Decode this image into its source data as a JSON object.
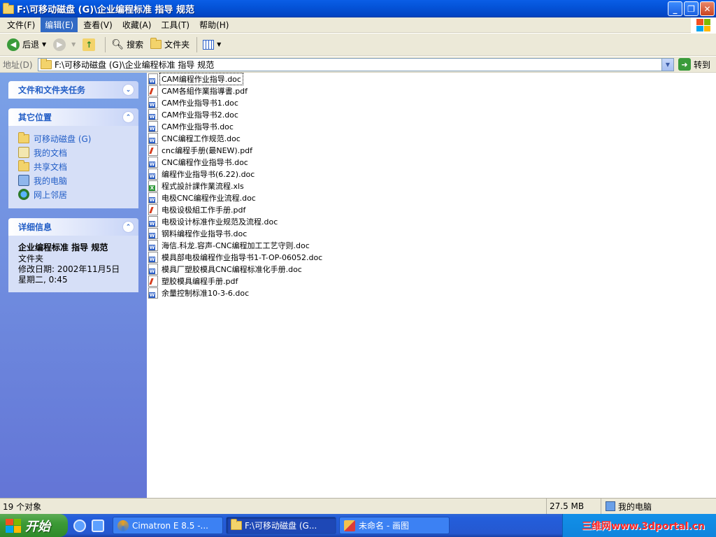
{
  "window": {
    "title": "F:\\可移动磁盘 (G)\\企业编程标准 指导 规范",
    "buttons": {
      "minimize": "_",
      "maximize": "❐",
      "close": "✕"
    }
  },
  "menu": [
    {
      "label": "文件(F)"
    },
    {
      "label": "编辑(E)"
    },
    {
      "label": "查看(V)"
    },
    {
      "label": "收藏(A)"
    },
    {
      "label": "工具(T)"
    },
    {
      "label": "帮助(H)"
    }
  ],
  "menu_active_index": 1,
  "toolbar": {
    "back": "后退",
    "search": "搜索",
    "folders": "文件夹"
  },
  "address": {
    "label": "地址(D)",
    "value": "F:\\可移动磁盘 (G)\\企业编程标准 指导 规范",
    "go": "转到"
  },
  "taskpane": {
    "tasks_title": "文件和文件夹任务",
    "other_title": "其它位置",
    "other_links": [
      {
        "label": "可移动磁盘 (G)",
        "icon": "folder-icon"
      },
      {
        "label": "我的文档",
        "icon": "documents-icon"
      },
      {
        "label": "共享文档",
        "icon": "folder-icon"
      },
      {
        "label": "我的电脑",
        "icon": "computer-icon"
      },
      {
        "label": "网上邻居",
        "icon": "network-icon"
      }
    ],
    "details_title": "详细信息",
    "details": {
      "name": "企业编程标准 指导 规范",
      "type": "文件夹",
      "modified_label": "修改日期: 2002年11月5日",
      "modified_time": "星期二, 0:45"
    }
  },
  "files": [
    {
      "name": "CAM编程作业指导.doc",
      "type": "doc"
    },
    {
      "name": "CAM各組作業指導書.pdf",
      "type": "pdf"
    },
    {
      "name": "CAM作业指导书1.doc",
      "type": "doc"
    },
    {
      "name": "CAM作业指导书2.doc",
      "type": "doc"
    },
    {
      "name": "CAM作业指导书.doc",
      "type": "doc"
    },
    {
      "name": "CNC编程工作规范.doc",
      "type": "doc"
    },
    {
      "name": "cnc编程手册(最NEW).pdf",
      "type": "pdf"
    },
    {
      "name": "CNC编程作业指导书.doc",
      "type": "doc"
    },
    {
      "name": "编程作业指导书(6.22).doc",
      "type": "doc"
    },
    {
      "name": "程式設計課作業流程.xls",
      "type": "xls"
    },
    {
      "name": "电极CNC编程作业流程.doc",
      "type": "doc"
    },
    {
      "name": "电极设极組工作手册.pdf",
      "type": "pdf"
    },
    {
      "name": "电极设计标准作业规范及流程.doc",
      "type": "doc"
    },
    {
      "name": "钢料编程作业指导书.doc",
      "type": "doc"
    },
    {
      "name": "海信.科龙.容声-CNC编程加工工艺守则.doc",
      "type": "doc"
    },
    {
      "name": "模具部电极编程作业指导书1-T-OP-06052.doc",
      "type": "doc"
    },
    {
      "name": "模具厂塑胶模具CNC编程标准化手册.doc",
      "type": "doc"
    },
    {
      "name": "塑胶模具编程手册.pdf",
      "type": "pdf"
    },
    {
      "name": "余量控制标准10-3-6.doc",
      "type": "doc"
    }
  ],
  "status": {
    "count": "19 个对象",
    "size": "27.5 MB",
    "location": "我的电脑"
  },
  "taskbar": {
    "start": "开始",
    "tasks": [
      {
        "label": "Cimatron E 8.5 -...",
        "active": false
      },
      {
        "label": "F:\\可移动磁盘 (G...",
        "active": true
      },
      {
        "label": "未命名 - 画图",
        "active": false
      }
    ],
    "watermark": "三维网www.3dportal.cn"
  }
}
